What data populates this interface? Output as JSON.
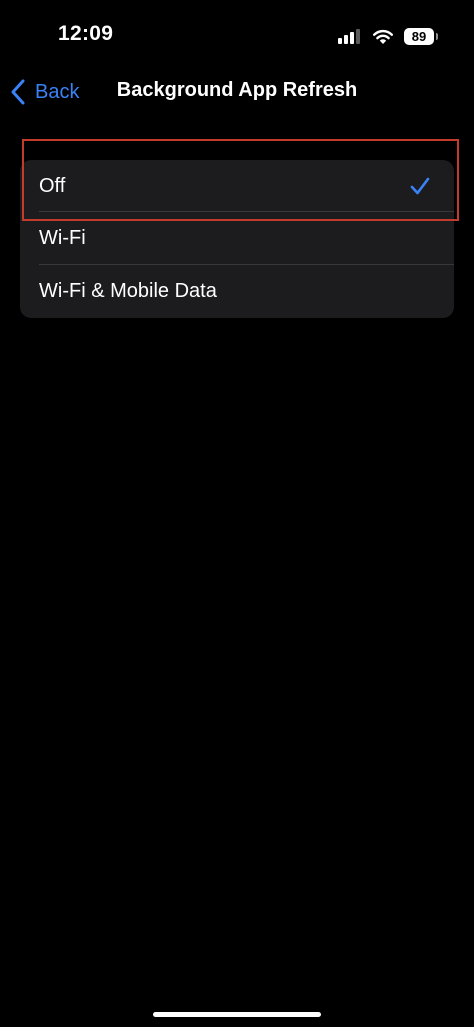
{
  "status_bar": {
    "time": "12:09",
    "battery_level": "89",
    "icons": [
      "cellular-signal-icon",
      "wifi-icon",
      "battery-icon"
    ]
  },
  "nav": {
    "back_label": "Back",
    "title": "Background App Refresh"
  },
  "options": [
    {
      "label": "Off",
      "selected": true
    },
    {
      "label": "Wi-Fi",
      "selected": false
    },
    {
      "label": "Wi-Fi & Mobile Data",
      "selected": false
    }
  ],
  "colors": {
    "accent": "#3a82f7",
    "background": "#000000",
    "group_background": "#1c1c1e",
    "separator": "#38383a",
    "highlight": "#c23b2b"
  }
}
